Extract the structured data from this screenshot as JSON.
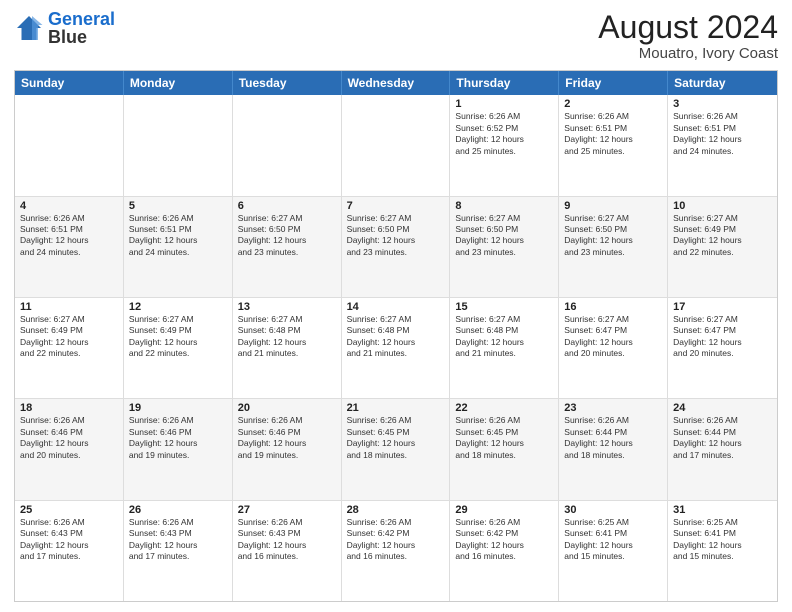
{
  "logo": {
    "line1": "General",
    "line2": "Blue"
  },
  "header": {
    "month_year": "August 2024",
    "location": "Mouatro, Ivory Coast"
  },
  "days": [
    "Sunday",
    "Monday",
    "Tuesday",
    "Wednesday",
    "Thursday",
    "Friday",
    "Saturday"
  ],
  "rows": [
    [
      {
        "day": "",
        "text": ""
      },
      {
        "day": "",
        "text": ""
      },
      {
        "day": "",
        "text": ""
      },
      {
        "day": "",
        "text": ""
      },
      {
        "day": "1",
        "text": "Sunrise: 6:26 AM\nSunset: 6:52 PM\nDaylight: 12 hours\nand 25 minutes."
      },
      {
        "day": "2",
        "text": "Sunrise: 6:26 AM\nSunset: 6:51 PM\nDaylight: 12 hours\nand 25 minutes."
      },
      {
        "day": "3",
        "text": "Sunrise: 6:26 AM\nSunset: 6:51 PM\nDaylight: 12 hours\nand 24 minutes."
      }
    ],
    [
      {
        "day": "4",
        "text": "Sunrise: 6:26 AM\nSunset: 6:51 PM\nDaylight: 12 hours\nand 24 minutes."
      },
      {
        "day": "5",
        "text": "Sunrise: 6:26 AM\nSunset: 6:51 PM\nDaylight: 12 hours\nand 24 minutes."
      },
      {
        "day": "6",
        "text": "Sunrise: 6:27 AM\nSunset: 6:50 PM\nDaylight: 12 hours\nand 23 minutes."
      },
      {
        "day": "7",
        "text": "Sunrise: 6:27 AM\nSunset: 6:50 PM\nDaylight: 12 hours\nand 23 minutes."
      },
      {
        "day": "8",
        "text": "Sunrise: 6:27 AM\nSunset: 6:50 PM\nDaylight: 12 hours\nand 23 minutes."
      },
      {
        "day": "9",
        "text": "Sunrise: 6:27 AM\nSunset: 6:50 PM\nDaylight: 12 hours\nand 23 minutes."
      },
      {
        "day": "10",
        "text": "Sunrise: 6:27 AM\nSunset: 6:49 PM\nDaylight: 12 hours\nand 22 minutes."
      }
    ],
    [
      {
        "day": "11",
        "text": "Sunrise: 6:27 AM\nSunset: 6:49 PM\nDaylight: 12 hours\nand 22 minutes."
      },
      {
        "day": "12",
        "text": "Sunrise: 6:27 AM\nSunset: 6:49 PM\nDaylight: 12 hours\nand 22 minutes."
      },
      {
        "day": "13",
        "text": "Sunrise: 6:27 AM\nSunset: 6:48 PM\nDaylight: 12 hours\nand 21 minutes."
      },
      {
        "day": "14",
        "text": "Sunrise: 6:27 AM\nSunset: 6:48 PM\nDaylight: 12 hours\nand 21 minutes."
      },
      {
        "day": "15",
        "text": "Sunrise: 6:27 AM\nSunset: 6:48 PM\nDaylight: 12 hours\nand 21 minutes."
      },
      {
        "day": "16",
        "text": "Sunrise: 6:27 AM\nSunset: 6:47 PM\nDaylight: 12 hours\nand 20 minutes."
      },
      {
        "day": "17",
        "text": "Sunrise: 6:27 AM\nSunset: 6:47 PM\nDaylight: 12 hours\nand 20 minutes."
      }
    ],
    [
      {
        "day": "18",
        "text": "Sunrise: 6:26 AM\nSunset: 6:46 PM\nDaylight: 12 hours\nand 20 minutes."
      },
      {
        "day": "19",
        "text": "Sunrise: 6:26 AM\nSunset: 6:46 PM\nDaylight: 12 hours\nand 19 minutes."
      },
      {
        "day": "20",
        "text": "Sunrise: 6:26 AM\nSunset: 6:46 PM\nDaylight: 12 hours\nand 19 minutes."
      },
      {
        "day": "21",
        "text": "Sunrise: 6:26 AM\nSunset: 6:45 PM\nDaylight: 12 hours\nand 18 minutes."
      },
      {
        "day": "22",
        "text": "Sunrise: 6:26 AM\nSunset: 6:45 PM\nDaylight: 12 hours\nand 18 minutes."
      },
      {
        "day": "23",
        "text": "Sunrise: 6:26 AM\nSunset: 6:44 PM\nDaylight: 12 hours\nand 18 minutes."
      },
      {
        "day": "24",
        "text": "Sunrise: 6:26 AM\nSunset: 6:44 PM\nDaylight: 12 hours\nand 17 minutes."
      }
    ],
    [
      {
        "day": "25",
        "text": "Sunrise: 6:26 AM\nSunset: 6:43 PM\nDaylight: 12 hours\nand 17 minutes."
      },
      {
        "day": "26",
        "text": "Sunrise: 6:26 AM\nSunset: 6:43 PM\nDaylight: 12 hours\nand 17 minutes."
      },
      {
        "day": "27",
        "text": "Sunrise: 6:26 AM\nSunset: 6:43 PM\nDaylight: 12 hours\nand 16 minutes."
      },
      {
        "day": "28",
        "text": "Sunrise: 6:26 AM\nSunset: 6:42 PM\nDaylight: 12 hours\nand 16 minutes."
      },
      {
        "day": "29",
        "text": "Sunrise: 6:26 AM\nSunset: 6:42 PM\nDaylight: 12 hours\nand 16 minutes."
      },
      {
        "day": "30",
        "text": "Sunrise: 6:25 AM\nSunset: 6:41 PM\nDaylight: 12 hours\nand 15 minutes."
      },
      {
        "day": "31",
        "text": "Sunrise: 6:25 AM\nSunset: 6:41 PM\nDaylight: 12 hours\nand 15 minutes."
      }
    ]
  ]
}
